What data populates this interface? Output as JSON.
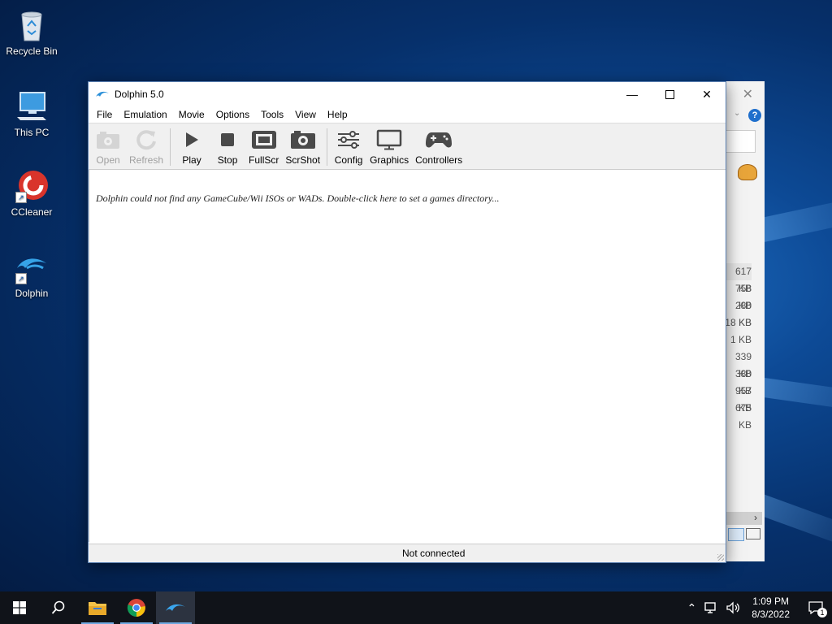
{
  "desktop": {
    "icons": [
      {
        "label": "Recycle Bin"
      },
      {
        "label": "This PC"
      },
      {
        "label": "CCleaner"
      },
      {
        "label": "Dolphin"
      }
    ]
  },
  "back_window": {
    "file_sizes": [
      "617 KB",
      "758 KB",
      "280 KB",
      "18 KB",
      "1 KB",
      "339 KB",
      "380 KB",
      "957 KB",
      "675 KB"
    ]
  },
  "window": {
    "title": "Dolphin 5.0",
    "menu": [
      "File",
      "Emulation",
      "Movie",
      "Options",
      "Tools",
      "View",
      "Help"
    ],
    "toolbar": {
      "open": "Open",
      "refresh": "Refresh",
      "play": "Play",
      "stop": "Stop",
      "fullscr": "FullScr",
      "scrshot": "ScrShot",
      "config": "Config",
      "graphics": "Graphics",
      "controllers": "Controllers"
    },
    "empty_message": "Dolphin could not find any GameCube/Wii ISOs or WADs. Double-click here to set a games directory...",
    "status": "Not connected"
  },
  "taskbar": {
    "time": "1:09 PM",
    "date": "8/3/2022",
    "notification_count": "1"
  },
  "colors": {
    "dolphin_blue": "#2a8fd8",
    "taskbar": "#101319",
    "active_underline": "#6fa8e0"
  }
}
